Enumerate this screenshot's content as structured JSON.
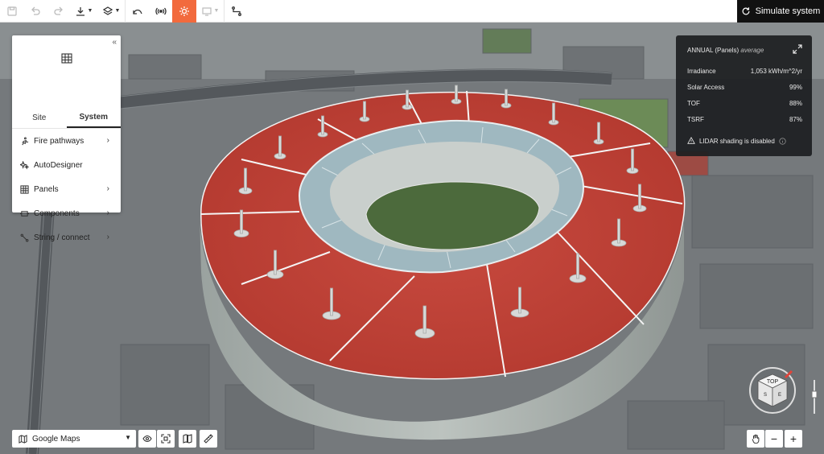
{
  "toolbar": {
    "simulate_label": "Simulate system",
    "accent_color": "#f26a3d"
  },
  "side_panel": {
    "tabs": [
      {
        "label": "Site",
        "active": false
      },
      {
        "label": "System",
        "active": true
      }
    ],
    "items": [
      {
        "label": "Fire pathways",
        "icon": "person-running-icon",
        "has_submenu": true
      },
      {
        "label": "AutoDesigner",
        "icon": "sparkle-icon",
        "has_submenu": false
      },
      {
        "label": "Panels",
        "icon": "grid-icon",
        "has_submenu": true
      },
      {
        "label": "Components",
        "icon": "component-icon",
        "has_submenu": true
      },
      {
        "label": "String / connect",
        "icon": "string-icon",
        "has_submenu": true
      }
    ]
  },
  "stats": {
    "header_main": "ANNUAL (Panels)",
    "header_sub": "average",
    "rows": [
      {
        "label": "Irradiance",
        "value": "1,053 kWh/m^2/yr"
      },
      {
        "label": "Solar Access",
        "value": "99%"
      },
      {
        "label": "TOF",
        "value": "88%"
      },
      {
        "label": "TSRF",
        "value": "87%"
      }
    ],
    "warning": "LIDAR shading is disabled"
  },
  "map_select": {
    "value": "Google Maps"
  },
  "compass": {
    "top_label": "TOP",
    "side_labels": [
      "S",
      "E"
    ]
  },
  "zoom": {
    "minus": "−",
    "plus": "+"
  }
}
